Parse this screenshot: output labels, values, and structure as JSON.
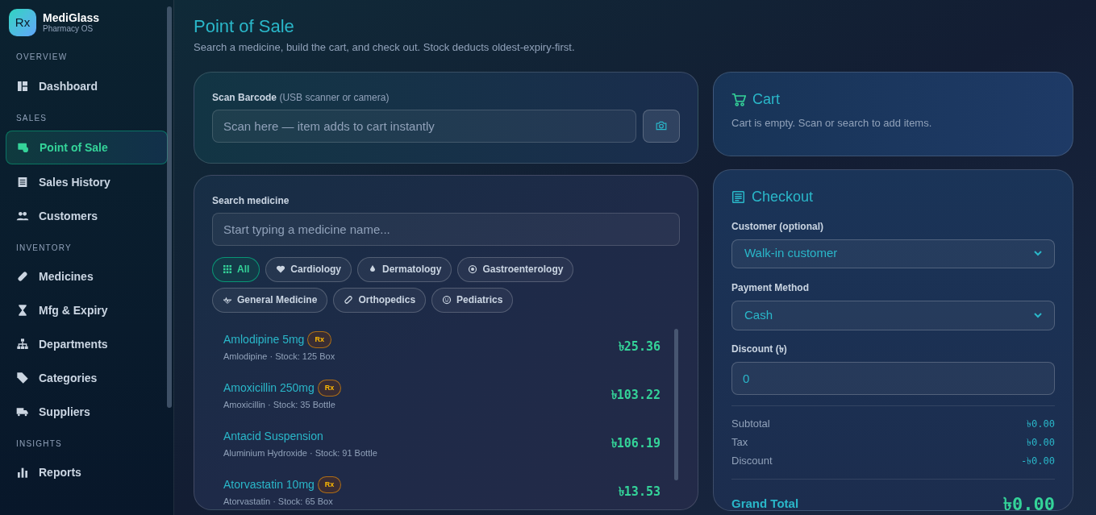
{
  "brand": {
    "logo": "Rx",
    "name": "MediGlass",
    "subtitle": "Pharmacy OS"
  },
  "sidebar": {
    "sections": [
      {
        "heading": "OVERVIEW",
        "items": [
          {
            "label": "Dashboard",
            "selected": false
          }
        ]
      },
      {
        "heading": "SALES",
        "items": [
          {
            "label": "Point of Sale",
            "selected": true
          },
          {
            "label": "Sales History",
            "selected": false
          },
          {
            "label": "Customers",
            "selected": false
          }
        ]
      },
      {
        "heading": "INVENTORY",
        "items": [
          {
            "label": "Medicines",
            "selected": false
          },
          {
            "label": "Mfg & Expiry",
            "selected": false
          },
          {
            "label": "Departments",
            "selected": false
          },
          {
            "label": "Categories",
            "selected": false
          },
          {
            "label": "Suppliers",
            "selected": false
          }
        ]
      },
      {
        "heading": "INSIGHTS",
        "items": [
          {
            "label": "Reports",
            "selected": false
          }
        ]
      }
    ]
  },
  "page": {
    "title": "Point of Sale",
    "subtitle": "Search a medicine, build the cart, and check out. Stock deducts oldest-expiry-first."
  },
  "barcode": {
    "label": "Scan Barcode",
    "hint": "(USB scanner or camera)",
    "placeholder": "Scan here — item adds to cart instantly"
  },
  "search": {
    "label": "Search medicine",
    "placeholder": "Start typing a medicine name...",
    "chips": [
      {
        "label": "All",
        "selected": true
      },
      {
        "label": "Cardiology",
        "selected": false
      },
      {
        "label": "Dermatology",
        "selected": false
      },
      {
        "label": "Gastroenterology",
        "selected": false
      },
      {
        "label": "General Medicine",
        "selected": false
      },
      {
        "label": "Orthopedics",
        "selected": false
      },
      {
        "label": "Pediatrics",
        "selected": false
      }
    ],
    "results": [
      {
        "name": "Amlodipine 5mg",
        "badge": "Rx",
        "detail": "Amlodipine · Stock: 125 Box",
        "price": "৳25.36"
      },
      {
        "name": "Amoxicillin 250mg",
        "badge": "Rx",
        "detail": "Amoxicillin · Stock: 35 Bottle",
        "price": "৳103.22"
      },
      {
        "name": "Antacid Suspension",
        "detail": "Aluminium Hydroxide · Stock: 91 Bottle",
        "price": "৳106.19"
      },
      {
        "name": "Atorvastatin 10mg",
        "badge": "Rx",
        "detail": "Atorvastatin · Stock: 65 Box",
        "price": "৳13.53"
      }
    ]
  },
  "cart": {
    "title": "Cart",
    "empty_text": "Cart is empty. Scan or search to add items."
  },
  "checkout": {
    "title": "Checkout",
    "customer_label": "Customer (optional)",
    "customer": "Walk-in customer",
    "payment_label": "Payment Method",
    "payment": "Cash",
    "discount_label": "Discount (৳)",
    "discount": "0",
    "lines": [
      {
        "label": "Subtotal",
        "value": "৳0.00"
      },
      {
        "label": "Tax",
        "value": "৳0.00"
      },
      {
        "label": "Discount",
        "value": "-৳0.00"
      }
    ],
    "total_label": "Grand Total",
    "total": "৳0.00"
  }
}
